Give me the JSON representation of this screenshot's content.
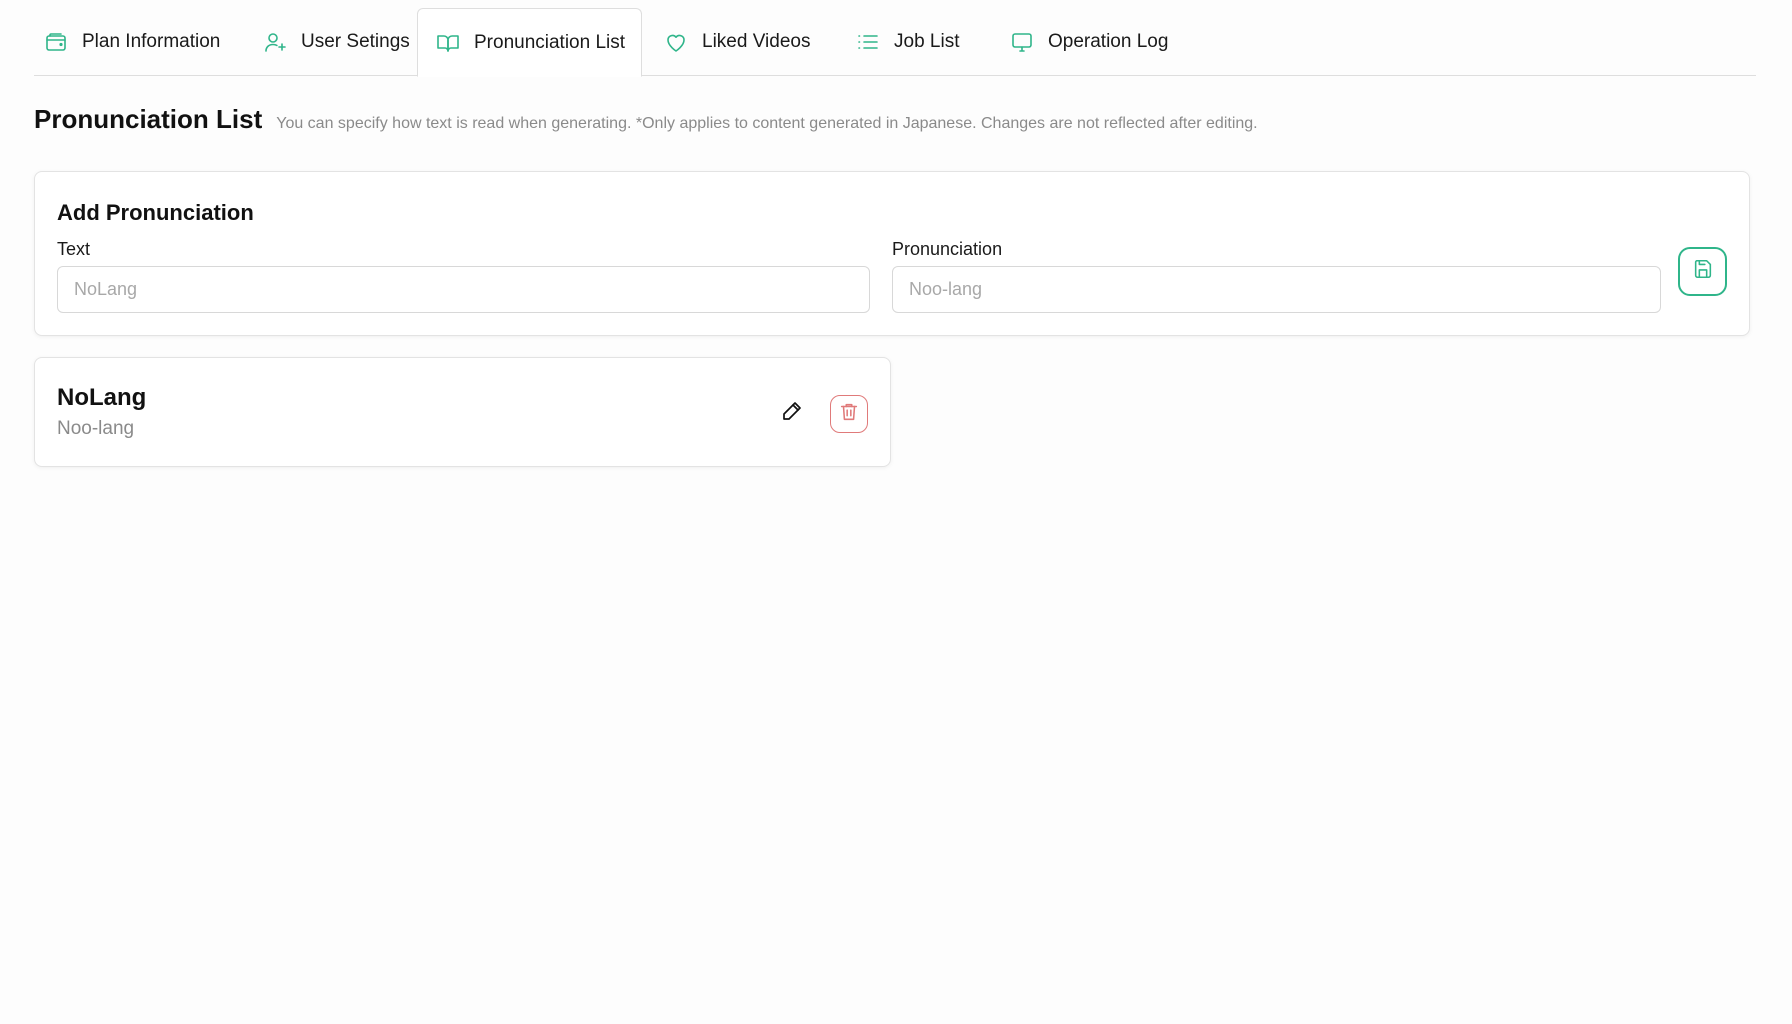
{
  "tabs": [
    {
      "label": "Plan Information",
      "icon": "wallet-icon"
    },
    {
      "label": "User Setings",
      "icon": "user-plus-icon"
    },
    {
      "label": "Pronunciation List",
      "icon": "book-open-icon",
      "active": true
    },
    {
      "label": "Liked Videos",
      "icon": "heart-icon"
    },
    {
      "label": "Job List",
      "icon": "list-icon"
    },
    {
      "label": "Operation Log",
      "icon": "monitor-icon"
    }
  ],
  "page": {
    "title": "Pronunciation List",
    "description": "You can specify how text is read when generating. *Only applies to content generated in Japanese. Changes are not reflected after editing."
  },
  "add_form": {
    "title": "Add Pronunciation",
    "text_label": "Text",
    "text_placeholder": "NoLang",
    "pronunciation_label": "Pronunciation",
    "pronunciation_placeholder": "Noo-lang",
    "save_icon": "save-icon"
  },
  "entries": [
    {
      "text": "NoLang",
      "pronunciation": "Noo-lang"
    }
  ],
  "colors": {
    "accent": "#2fb58a",
    "danger": "#e07a7a",
    "muted_text": "#8a8a8a"
  }
}
